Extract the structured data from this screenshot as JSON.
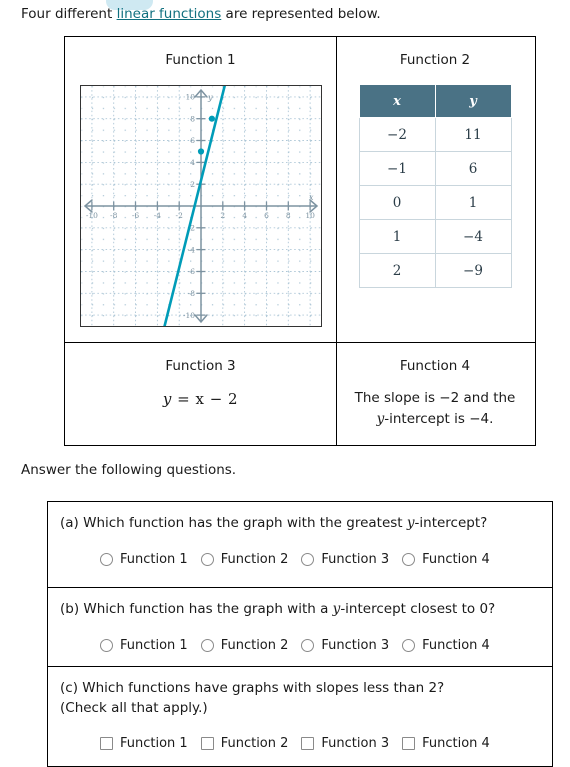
{
  "intro": {
    "before": "Four different ",
    "link": "linear functions",
    "after": " are represented below."
  },
  "functions": {
    "f1": {
      "title": "Function 1",
      "graph": {
        "type": "line",
        "xlim": [
          -11,
          11
        ],
        "ylim": [
          -11,
          11
        ],
        "xticks": [
          -10,
          -8,
          -6,
          -4,
          -2,
          2,
          4,
          6,
          8,
          10
        ],
        "yticks": [
          -10,
          -8,
          -6,
          -4,
          -2,
          2,
          4,
          6,
          8,
          10
        ],
        "xlabel": "x",
        "ylabel": "y",
        "grid": true,
        "slope": 3,
        "intercept": 5,
        "points": [
          [
            0,
            5
          ],
          [
            1,
            8
          ]
        ],
        "line_color": "#009CB8",
        "axis_color": "#7d93a1",
        "grid_color": "#a9c4d4"
      }
    },
    "f2": {
      "title": "Function 2",
      "table": {
        "headers": [
          "x",
          "y"
        ],
        "rows": [
          [
            "−2",
            "11"
          ],
          [
            "−1",
            "6"
          ],
          [
            "0",
            "1"
          ],
          [
            "1",
            "−4"
          ],
          [
            "2",
            "−9"
          ]
        ],
        "header_bg": "#4a7285",
        "header_fg": "#ffffff"
      }
    },
    "f3": {
      "title": "Function 3",
      "equation_y": "y",
      "equation_rest": " = x − 2"
    },
    "f4": {
      "title": "Function 4",
      "desc_1": "The slope is −2 and the",
      "desc_y": "y",
      "desc_2": "-intercept is −4."
    }
  },
  "answer_lead": "Answer the following questions.",
  "questions": [
    {
      "id": "a",
      "prefix": "(a) Which function has the graph with the greatest ",
      "italic": "y",
      "suffix": "-intercept?",
      "input_type": "radio",
      "options": [
        "Function 1",
        "Function 2",
        "Function 3",
        "Function 4"
      ]
    },
    {
      "id": "b",
      "prefix": "(b) Which function has the graph with a ",
      "italic": "y",
      "suffix": "-intercept closest to 0?",
      "input_type": "radio",
      "options": [
        "Function 1",
        "Function 2",
        "Function 3",
        "Function 4"
      ]
    },
    {
      "id": "c",
      "prefix": "(c) Which functions have graphs with slopes less than 2?",
      "italic": "",
      "suffix": "",
      "line2": "(Check all that apply.)",
      "input_type": "checkbox",
      "options": [
        "Function 1",
        "Function 2",
        "Function 3",
        "Function 4"
      ]
    }
  ]
}
